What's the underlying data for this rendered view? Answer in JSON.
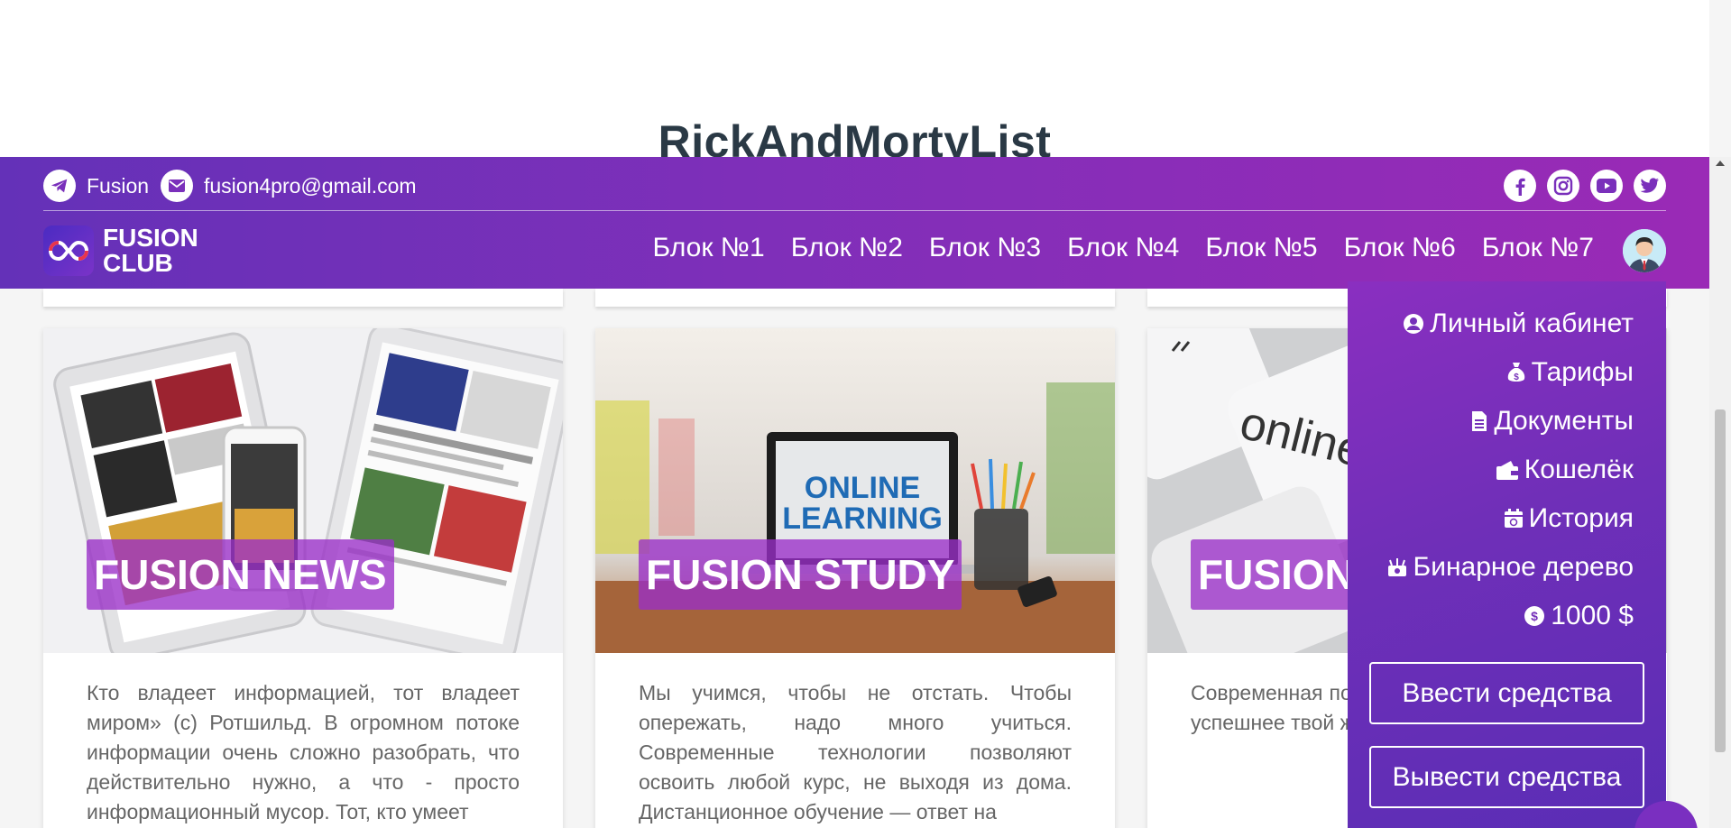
{
  "page": {
    "heading": "RickAndMortyList"
  },
  "header": {
    "contacts": {
      "telegram": "Fusion",
      "email": "fusion4pro@gmail.com"
    },
    "social_icons": [
      "facebook-icon",
      "instagram-icon",
      "youtube-icon",
      "twitter-icon"
    ],
    "logo": {
      "line1": "FUSION",
      "line2": "CLUB"
    },
    "nav": [
      "Блок №1",
      "Блок №2",
      "Блок №3",
      "Блок №4",
      "Блок №5",
      "Блок №6",
      "Блок №7"
    ]
  },
  "cards": [
    {
      "label": "FUSION NEWS",
      "image_text": [],
      "text": "Кто владеет информацией, тот владеет миром» (с) Ротшильд. В огромном потоке информации очень сложно разобрать, что действительно нужно, а что - просто информационный мусор. Тот, кто умеет"
    },
    {
      "label": "FUSION STUDY",
      "image_text": [
        "ONLINE",
        "LEARNING"
      ],
      "text": "Мы учимся, чтобы не отстать. Чтобы опережать, надо много учиться. Современные технологии позволяют освоить любой курс, не выходя из дома. Дистанционное обучение — ответ на"
    },
    {
      "label": "FUSION",
      "image_text": [
        "online"
      ],
      "text": "Современная постоянный об Чем эффектив успешнее твой же важны качес"
    }
  ],
  "dropdown": {
    "items": [
      {
        "icon": "user-circle-icon",
        "label": "Личный кабинет"
      },
      {
        "icon": "money-bag-icon",
        "label": "Тарифы"
      },
      {
        "icon": "document-icon",
        "label": "Документы"
      },
      {
        "icon": "wallet-icon",
        "label": "Кошелёк"
      },
      {
        "icon": "calendar-icon",
        "label": "История"
      },
      {
        "icon": "binary-tree-icon",
        "label": "Бинарное дерево"
      },
      {
        "icon": "dollar-coin-icon",
        "label": "1000 $"
      }
    ],
    "deposit_button": "Ввести средства",
    "withdraw_button": "Вывести средства"
  },
  "colors": {
    "gradient_start": "#6431b8",
    "gradient_end": "#9a2ab6",
    "card_label_bg": "#9a2ec8",
    "heading": "#2a3945"
  }
}
